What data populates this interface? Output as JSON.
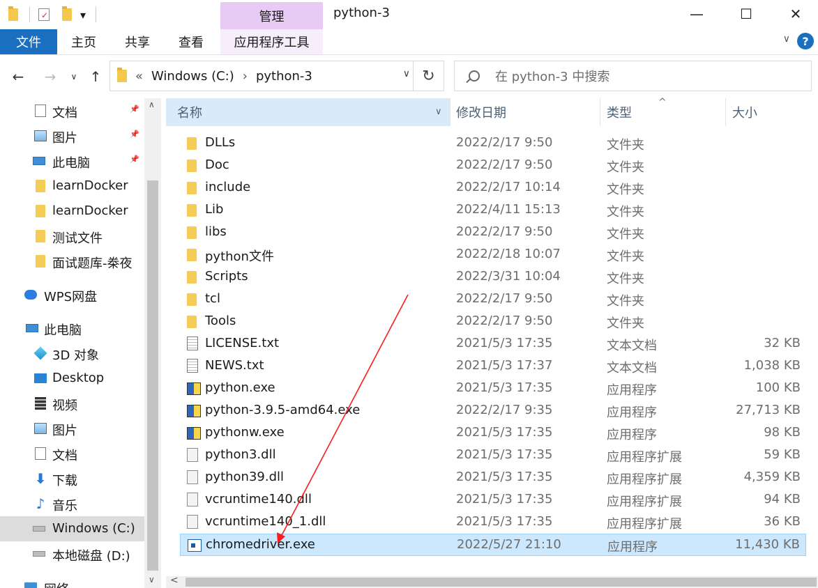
{
  "titlebar": {
    "manage_label": "管理",
    "title": "python-3",
    "dropdown_glyph": "▾",
    "minimize_glyph": "—",
    "maximize_glyph": "☐",
    "close_glyph": "✕"
  },
  "ribbon": {
    "tabs": [
      {
        "label": "文件"
      },
      {
        "label": "主页"
      },
      {
        "label": "共享"
      },
      {
        "label": "查看"
      },
      {
        "label": "应用程序工具"
      }
    ],
    "expand_glyph": "∨",
    "help_glyph": "?"
  },
  "nav": {
    "back_glyph": "←",
    "forward_glyph": "→",
    "recent_glyph": "∨",
    "up_glyph": "↑",
    "address_prefix": "«",
    "address_segments": [
      "Windows (C:)",
      "python-3"
    ],
    "address_separator": "›",
    "dropdown_glyph": "∨",
    "refresh_glyph": "↻",
    "search_placeholder": "在 python-3 中搜索"
  },
  "sidebar": {
    "items": [
      {
        "label": "文档",
        "icon": "document-icon",
        "pinned": true
      },
      {
        "label": "图片",
        "icon": "pictures-icon",
        "pinned": true
      },
      {
        "label": "此电脑",
        "icon": "computer-icon",
        "pinned": true
      },
      {
        "label": "learnDocker",
        "icon": "folder-icon"
      },
      {
        "label": "learnDocker",
        "icon": "folder-icon"
      },
      {
        "label": "测试文件",
        "icon": "folder-icon"
      },
      {
        "label": "面试题库-桊夜",
        "icon": "folder-icon"
      },
      {
        "label": "WPS网盘",
        "icon": "cloud-icon"
      },
      {
        "label": "此电脑",
        "icon": "computer-icon"
      },
      {
        "label": "3D 对象",
        "icon": "3d-objects-icon"
      },
      {
        "label": "Desktop",
        "icon": "desktop-icon"
      },
      {
        "label": "视频",
        "icon": "video-icon"
      },
      {
        "label": "图片",
        "icon": "pictures-icon"
      },
      {
        "label": "文档",
        "icon": "document-icon"
      },
      {
        "label": "下载",
        "icon": "download-icon"
      },
      {
        "label": "音乐",
        "icon": "music-icon"
      },
      {
        "label": "Windows (C:)",
        "icon": "drive-icon",
        "selected": true
      },
      {
        "label": "本地磁盘 (D:)",
        "icon": "drive-icon"
      },
      {
        "label": "网络",
        "icon": "network-icon"
      }
    ],
    "pin_glyph": "📌",
    "scroll_up_glyph": "∧",
    "scroll_down_glyph": "∨"
  },
  "columns": {
    "name": "名称",
    "date": "修改日期",
    "type": "类型",
    "size": "大小",
    "dropdown_glyph": "∨",
    "sort_glyph": "^"
  },
  "files": [
    {
      "name": "DLLs",
      "date": "2022/2/17 9:50",
      "type": "文件夹",
      "size": "",
      "kind": "folder"
    },
    {
      "name": "Doc",
      "date": "2022/2/17 9:50",
      "type": "文件夹",
      "size": "",
      "kind": "folder"
    },
    {
      "name": "include",
      "date": "2022/2/17 10:14",
      "type": "文件夹",
      "size": "",
      "kind": "folder"
    },
    {
      "name": "Lib",
      "date": "2022/4/11 15:13",
      "type": "文件夹",
      "size": "",
      "kind": "folder"
    },
    {
      "name": "libs",
      "date": "2022/2/17 9:50",
      "type": "文件夹",
      "size": "",
      "kind": "folder"
    },
    {
      "name": "python文件",
      "date": "2022/2/18 10:07",
      "type": "文件夹",
      "size": "",
      "kind": "folder"
    },
    {
      "name": "Scripts",
      "date": "2022/3/31 10:04",
      "type": "文件夹",
      "size": "",
      "kind": "folder"
    },
    {
      "name": "tcl",
      "date": "2022/2/17 9:50",
      "type": "文件夹",
      "size": "",
      "kind": "folder"
    },
    {
      "name": "Tools",
      "date": "2022/2/17 9:50",
      "type": "文件夹",
      "size": "",
      "kind": "folder"
    },
    {
      "name": "LICENSE.txt",
      "date": "2021/5/3 17:35",
      "type": "文本文档",
      "size": "32 KB",
      "kind": "txt"
    },
    {
      "name": "NEWS.txt",
      "date": "2021/5/3 17:37",
      "type": "文本文档",
      "size": "1,038 KB",
      "kind": "txt"
    },
    {
      "name": "python.exe",
      "date": "2021/5/3 17:35",
      "type": "应用程序",
      "size": "100 KB",
      "kind": "exe"
    },
    {
      "name": "python-3.9.5-amd64.exe",
      "date": "2022/2/17 9:35",
      "type": "应用程序",
      "size": "27,713 KB",
      "kind": "exe"
    },
    {
      "name": "pythonw.exe",
      "date": "2021/5/3 17:35",
      "type": "应用程序",
      "size": "98 KB",
      "kind": "exe"
    },
    {
      "name": "python3.dll",
      "date": "2021/5/3 17:35",
      "type": "应用程序扩展",
      "size": "59 KB",
      "kind": "dll"
    },
    {
      "name": "python39.dll",
      "date": "2021/5/3 17:35",
      "type": "应用程序扩展",
      "size": "4,359 KB",
      "kind": "dll"
    },
    {
      "name": "vcruntime140.dll",
      "date": "2021/5/3 17:35",
      "type": "应用程序扩展",
      "size": "94 KB",
      "kind": "dll"
    },
    {
      "name": "vcruntime140_1.dll",
      "date": "2021/5/3 17:35",
      "type": "应用程序扩展",
      "size": "36 KB",
      "kind": "dll"
    },
    {
      "name": "chromedriver.exe",
      "date": "2022/5/27 21:10",
      "type": "应用程序",
      "size": "11,430 KB",
      "kind": "chrome",
      "selected": true
    }
  ],
  "hscroll": {
    "left_glyph": "<"
  },
  "colors": {
    "accent": "#1a6fc1",
    "manage_tab": "#e8cbf5",
    "selection": "#cce8ff",
    "annotation_arrow": "#ff1a1a"
  }
}
